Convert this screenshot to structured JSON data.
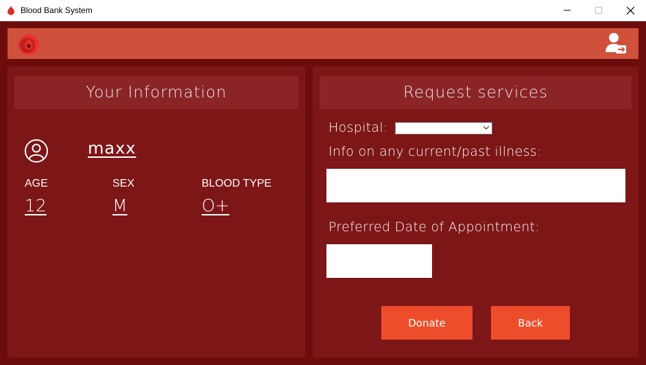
{
  "window": {
    "title": "Blood Bank System",
    "icons": [
      "blood-drop-icon",
      "minimize-icon",
      "maximize-icon",
      "close-icon"
    ]
  },
  "header": {
    "icons": [
      "blood-drop-logo-icon",
      "user-switch-icon"
    ],
    "color": "#cf513c"
  },
  "info_panel": {
    "title": "Your Information",
    "username": "maxx",
    "age_label": "AGE",
    "age": "12",
    "sex_label": "SEX",
    "sex": "M",
    "blood_type_label": "BLOOD TYPE",
    "blood_type": "O+"
  },
  "request_panel": {
    "title": "Request services",
    "hospital_label": "Hospital:",
    "hospital_selected": "",
    "illness_label": "Info on any current/past illness:",
    "illness_value": "",
    "date_label": "Preferred Date of Appointment:",
    "date_value": "",
    "donate_label": "Donate",
    "back_label": "Back"
  },
  "colors": {
    "background": "#6d0c0c",
    "panel": "#7d1617",
    "panel_header": "#8a2426",
    "button": "#ee4d2b"
  }
}
